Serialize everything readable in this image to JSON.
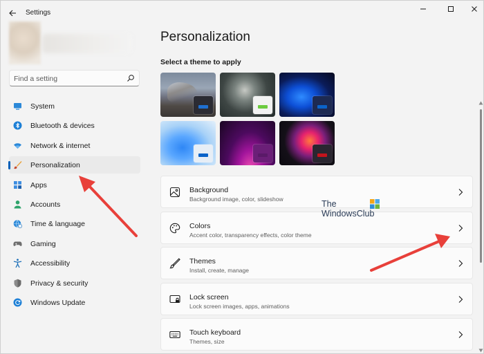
{
  "window": {
    "title": "Settings",
    "controls": [
      "minimize-icon",
      "maximize-icon",
      "close-icon"
    ]
  },
  "sidebar": {
    "search": {
      "placeholder": "Find a setting",
      "value": ""
    },
    "items": [
      {
        "label": "System",
        "icon": "monitor-icon",
        "active": false
      },
      {
        "label": "Bluetooth & devices",
        "icon": "bluetooth-icon",
        "active": false
      },
      {
        "label": "Network & internet",
        "icon": "wifi-icon",
        "active": false
      },
      {
        "label": "Personalization",
        "icon": "brush-icon",
        "active": true
      },
      {
        "label": "Apps",
        "icon": "apps-icon",
        "active": false
      },
      {
        "label": "Accounts",
        "icon": "person-icon",
        "active": false
      },
      {
        "label": "Time & language",
        "icon": "globe-clock-icon",
        "active": false
      },
      {
        "label": "Gaming",
        "icon": "gamepad-icon",
        "active": false
      },
      {
        "label": "Accessibility",
        "icon": "accessibility-icon",
        "active": false
      },
      {
        "label": "Privacy & security",
        "icon": "shield-icon",
        "active": false
      },
      {
        "label": "Windows Update",
        "icon": "update-icon",
        "active": false
      }
    ]
  },
  "main": {
    "title": "Personalization",
    "theme_section_label": "Select a theme to apply",
    "themes": [
      {
        "accent": "#1f6fd1",
        "swatch_bg": "#2b2b33"
      },
      {
        "accent": "#6ccb3f",
        "swatch_bg": "#f2f2f2"
      },
      {
        "accent": "#0a63c9",
        "swatch_bg": "#1d2a52"
      },
      {
        "accent": "#0a63c9",
        "swatch_bg": "#e7eef6"
      },
      {
        "accent": "#5a1a68",
        "swatch_bg": "#6b1f78"
      },
      {
        "accent": "#c3141c",
        "swatch_bg": "#2a2630"
      }
    ],
    "cards": [
      {
        "title": "Background",
        "subtitle": "Background image, color, slideshow",
        "icon": "image-icon"
      },
      {
        "title": "Colors",
        "subtitle": "Accent color, transparency effects, color theme",
        "icon": "palette-icon"
      },
      {
        "title": "Themes",
        "subtitle": "Install, create, manage",
        "icon": "pen-icon"
      },
      {
        "title": "Lock screen",
        "subtitle": "Lock screen images, apps, animations",
        "icon": "lock-screen-icon"
      },
      {
        "title": "Touch keyboard",
        "subtitle": "Themes, size",
        "icon": "keyboard-icon"
      }
    ]
  },
  "watermark": {
    "line1": "The",
    "line2": "WindowsClub"
  },
  "colors": {
    "accent": "#005fb8",
    "arrow": "#e8403a"
  }
}
